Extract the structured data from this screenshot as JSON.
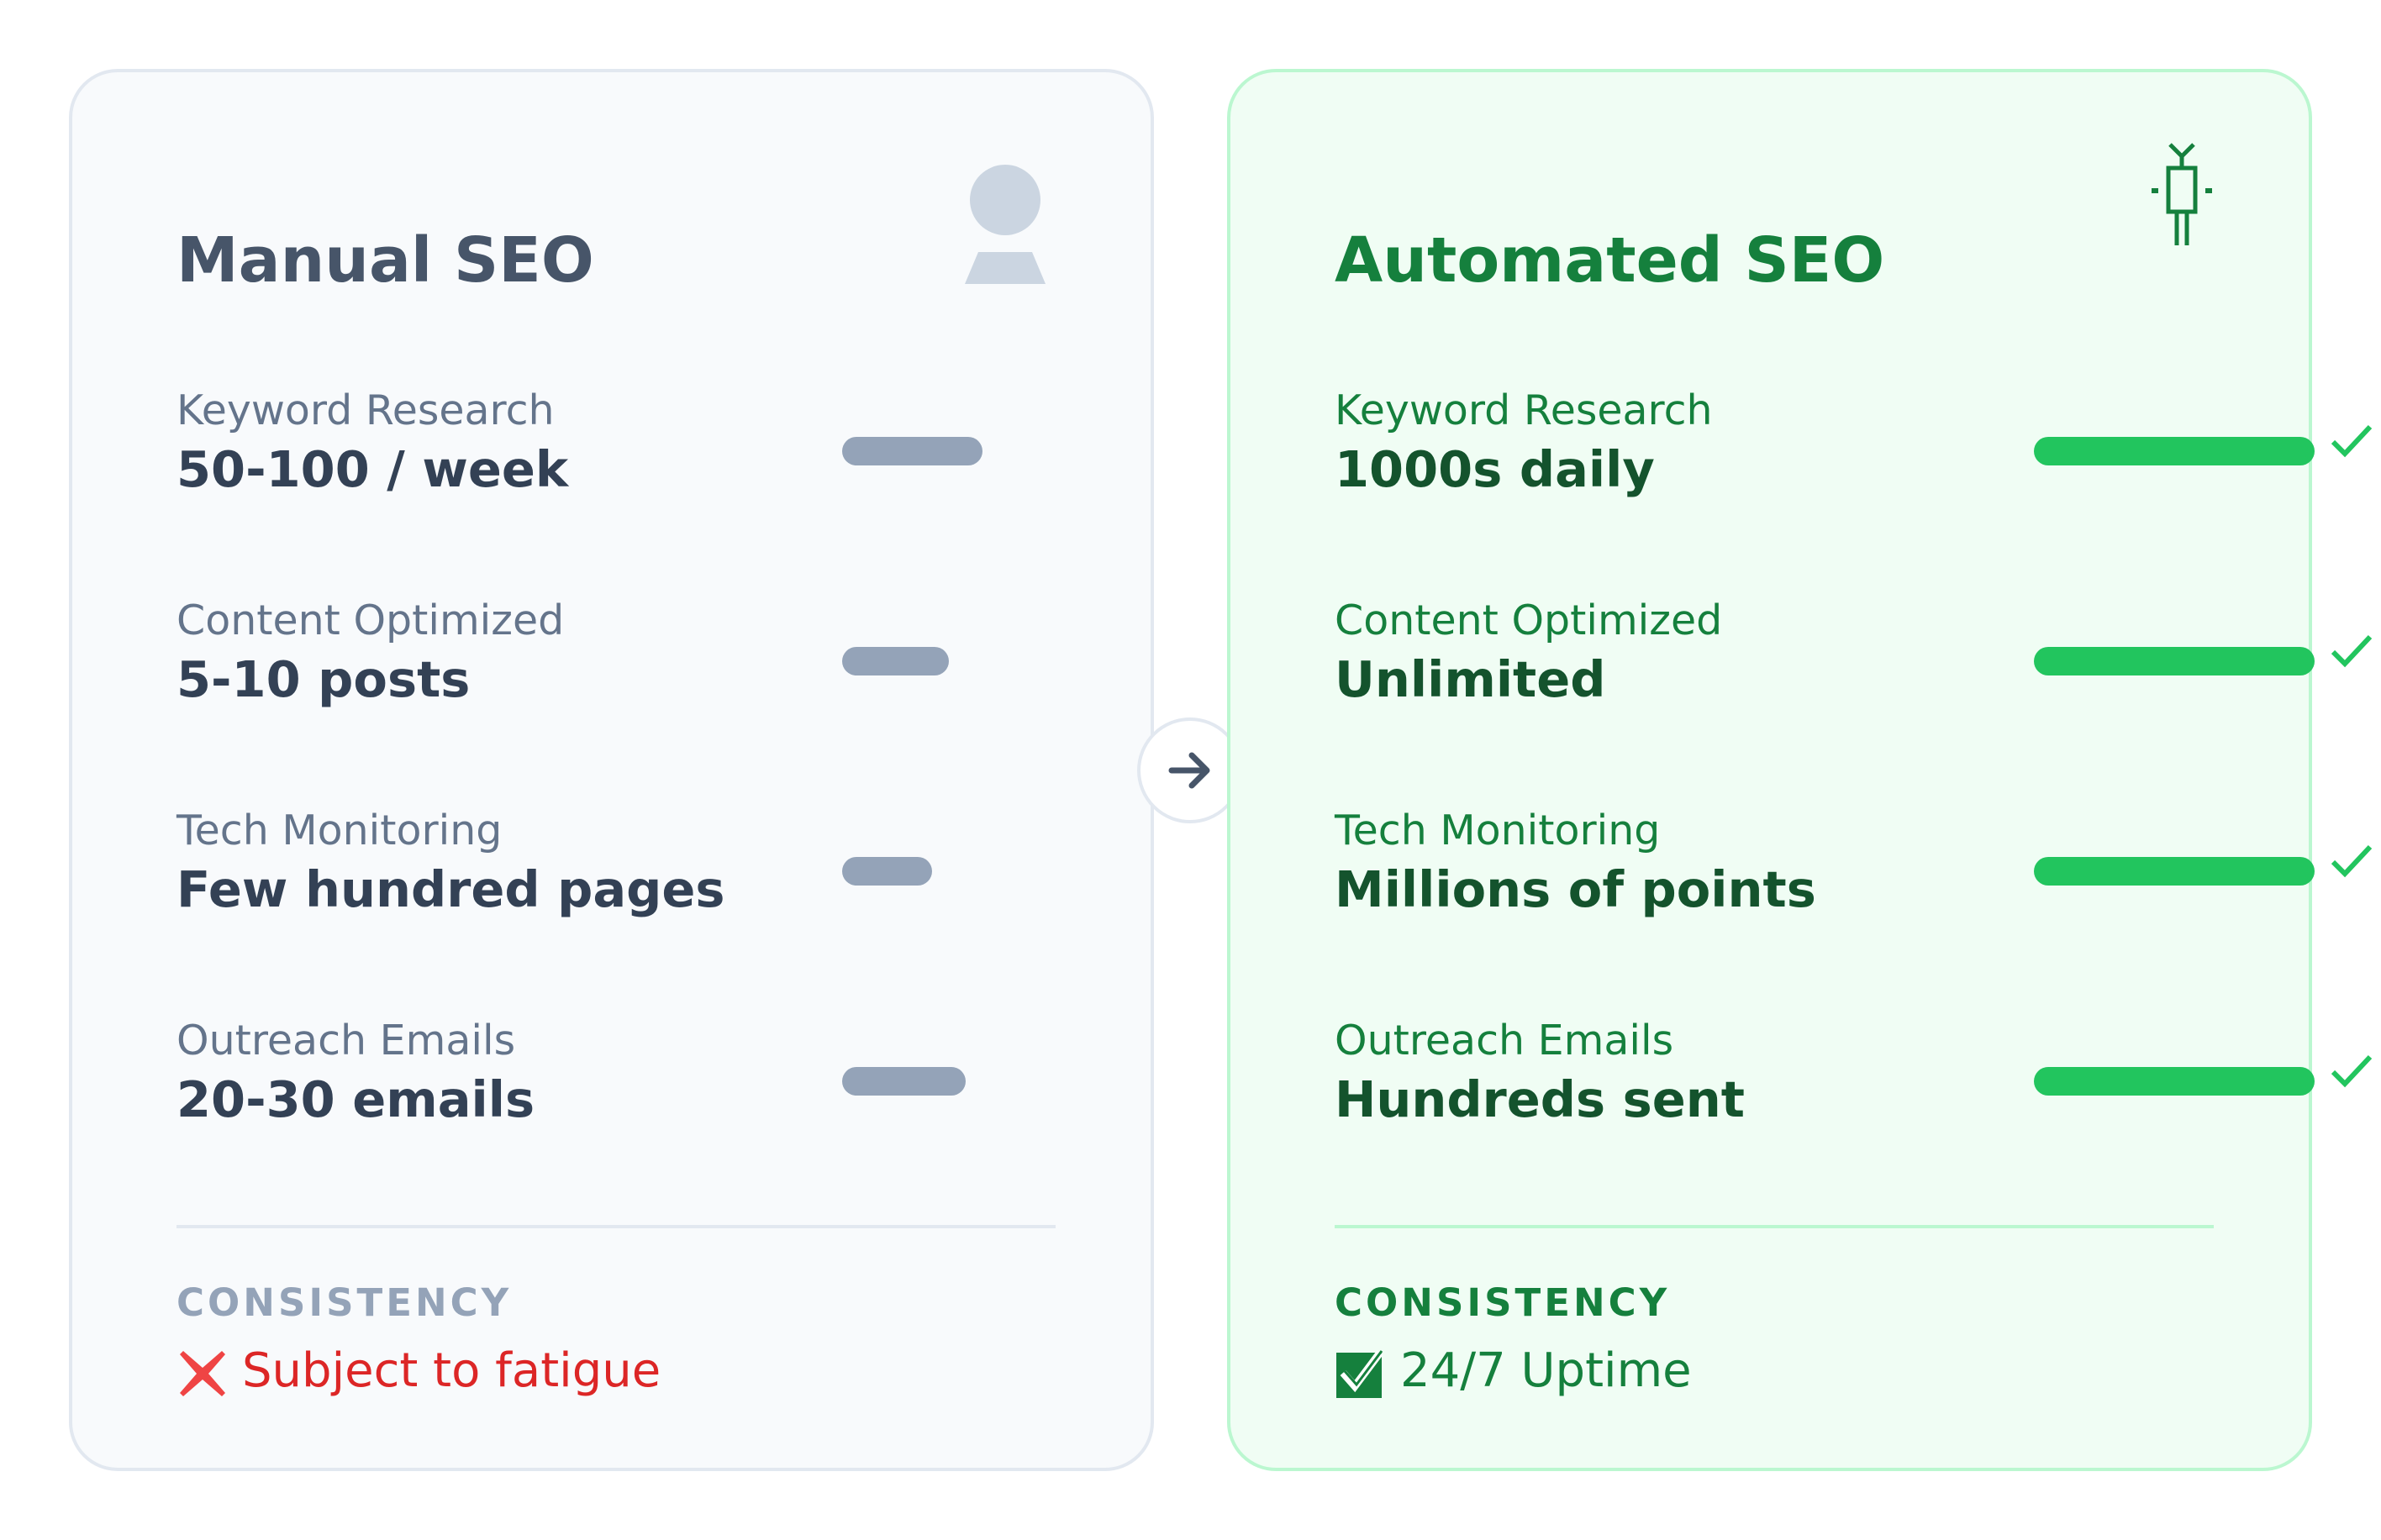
{
  "manual": {
    "title": "Manual SEO",
    "icon": "person-icon",
    "metrics": [
      {
        "label": "Keyword Research",
        "value": "50-100 / week",
        "level": 0.5
      },
      {
        "label": "Content Optimized",
        "value": "5-10 posts",
        "level": 0.38
      },
      {
        "label": "Tech Monitoring",
        "value": "Few hundred pages",
        "level": 0.32
      },
      {
        "label": "Outreach Emails",
        "value": "20-30 emails",
        "level": 0.44
      }
    ],
    "consistency_label": "CONSISTENCY",
    "consistency_icon": "red-x-icon",
    "consistency_text": "Subject to fatigue"
  },
  "automated": {
    "title": "Automated SEO",
    "icon": "robot-icon",
    "metrics": [
      {
        "label": "Keyword Research",
        "value": "1000s daily",
        "level": 1.0
      },
      {
        "label": "Content Optimized",
        "value": "Unlimited",
        "level": 1.0
      },
      {
        "label": "Tech Monitoring",
        "value": "Millions of points",
        "level": 1.0
      },
      {
        "label": "Outreach Emails",
        "value": "Hundreds sent",
        "level": 1.0
      }
    ],
    "consistency_label": "CONSISTENCY",
    "consistency_icon": "green-checkbox-icon",
    "consistency_text": "24/7 Uptime"
  },
  "transition_icon": "arrow-right-icon",
  "colors": {
    "manual_bar": "#94a3b8",
    "auto_bar": "#22c55e",
    "auto_accent": "#15803d",
    "fatigue_red": "#dc2626"
  }
}
